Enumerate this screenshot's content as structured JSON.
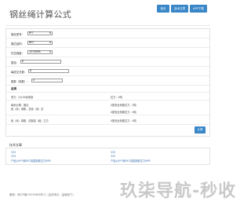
{
  "header": {
    "title": "钢丝绳计算公式",
    "nav": [
      "首页",
      "技术文章",
      "APP下载"
    ]
  },
  "form": {
    "fields": [
      {
        "label": "钢丝型号：",
        "value": "6*7",
        "type": "select"
      },
      {
        "label": "绳芯结构：",
        "value": "NFC",
        "type": "select"
      },
      {
        "label": "抗拉强度：",
        "value": "1570MPa",
        "type": "select"
      },
      {
        "label": "直径：",
        "value": "6",
        "type": "input"
      },
      {
        "label": "每层交叉数：",
        "value": "8",
        "type": "input"
      },
      {
        "label": "股数（段数）：",
        "value": "0",
        "type": "input"
      }
    ],
    "results_heading": "结果",
    "results": [
      {
        "left": "重力：0/100米重量",
        "right": "拉力：0吨"
      },
      {
        "left": "每米价格：钢丝",
        "right": "0按安全系数拉力：0吨"
      },
      {
        "left": "段（米）单数，总段（米）定",
        "right": "0按安全系数拉力：0吨"
      },
      {
        "left": "段（米）单数，总数量（段）立方",
        "right": "0按安全系数拉力：0吨"
      }
    ],
    "calculate_label": "计算"
  },
  "tech": {
    "heading": "技术文章",
    "links_left": [
      "333",
      "333",
      "产品从6*7和NFC到直钢铁拉力MPS"
    ],
    "links_right": [
      "333",
      "333",
      "产品从6*7和NFC到直钢铁拉力MPS"
    ]
  },
  "footer": {
    "text": "备案：琼ICP备19076386号-3（由其承办，监管部门）",
    "highlight": "琼ICP备19076386号-3"
  },
  "watermark": "玖柒导航-秒收",
  "colors": {
    "accent": "#3a87c8",
    "link": "#3a6fb0"
  }
}
